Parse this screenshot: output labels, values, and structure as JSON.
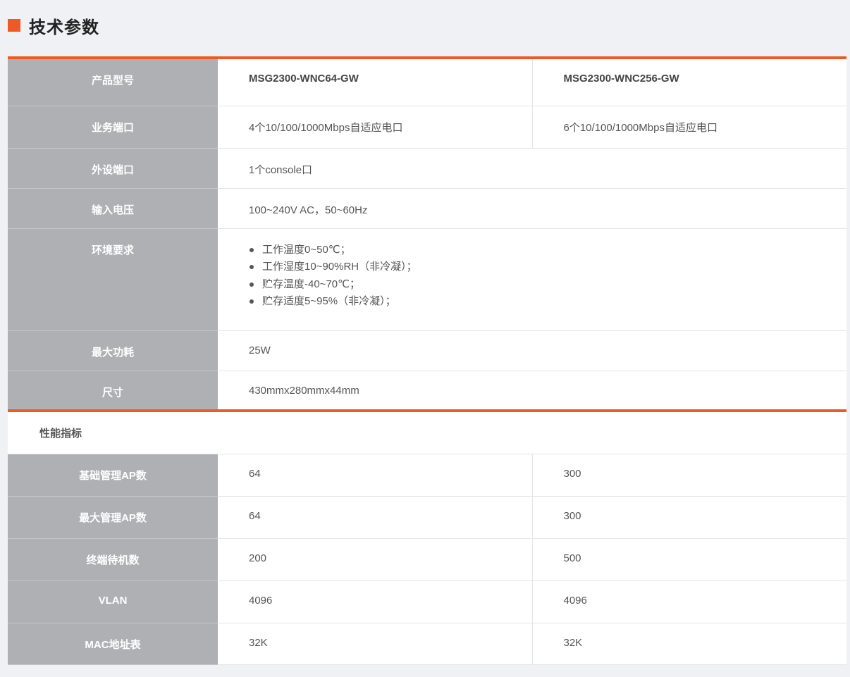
{
  "section": {
    "title": "技术参数"
  },
  "basic": {
    "model": {
      "label": "产品型号",
      "a": "MSG2300-WNC64-GW",
      "b": "MSG2300-WNC256-GW"
    },
    "ports": {
      "label": "业务端口",
      "a": "4个10/100/1000Mbps自适应电口",
      "b": "6个10/100/1000Mbps自适应电口"
    },
    "peripheral": {
      "label": "外设端口",
      "value": "1个console口"
    },
    "voltage": {
      "label": "输入电压",
      "value": "100~240V AC，50~60Hz"
    },
    "environment": {
      "label": "环境要求",
      "items": [
        "工作温度0~50℃；",
        "工作湿度10~90%RH（非冷凝）；",
        "贮存温度-40~70℃；",
        "贮存适度5~95%（非冷凝）；"
      ]
    },
    "power": {
      "label": "最大功耗",
      "value": "25W"
    },
    "size": {
      "label": "尺寸",
      "value": "430mmx280mmx44mm"
    }
  },
  "performance": {
    "heading": "性能指标",
    "rows": [
      {
        "label": "基础管理AP数",
        "a": "64",
        "b": "300"
      },
      {
        "label": "最大管理AP数",
        "a": "64",
        "b": "300"
      },
      {
        "label": "终端待机数",
        "a": "200",
        "b": "500"
      },
      {
        "label": "VLAN",
        "a": "4096",
        "b": "4096"
      },
      {
        "label": "MAC地址表",
        "a": "32K",
        "b": "32K"
      }
    ]
  },
  "colors": {
    "accent": "#ee5a24",
    "label_bg": "#aeb0b3",
    "page_bg": "#f0f1f5"
  }
}
